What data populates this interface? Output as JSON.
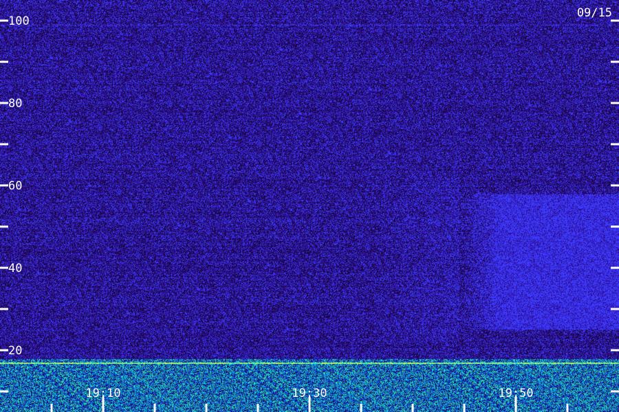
{
  "chart_data": {
    "type": "heatmap",
    "date_label": "09/15",
    "y_tick_labels": [
      "100",
      "80",
      "60",
      "40",
      "20"
    ],
    "y_ticks": [
      100,
      90,
      80,
      70,
      60,
      50,
      40,
      30,
      20,
      10
    ],
    "ylim": [
      5,
      105
    ],
    "x_tick_labels": [
      {
        "label": "19:10",
        "t": 10
      },
      {
        "label": "19:30",
        "t": 30
      },
      {
        "label": "19:50",
        "t": 50
      }
    ],
    "x_minor_ticks": [
      5,
      10,
      15,
      20,
      25,
      30,
      35,
      40,
      45,
      50,
      55
    ],
    "xlim": [
      0,
      60
    ],
    "colors": {
      "background": "#2a0d5a",
      "noise_dark": "#1a0840",
      "noise_mid": "#3a1aa0",
      "noise_bright": "#4a2ae8",
      "band_cyan": "#00c8e8",
      "band_green": "#50ff90",
      "band_yellow": "#e8ff40",
      "axis": "#ffffff"
    },
    "features": {
      "low_band_top": 18,
      "strong_line": 17,
      "line_100": 99,
      "enhanced_region": {
        "t_start": 44.5,
        "t_end": 60,
        "f_low": 25,
        "f_high": 58
      }
    }
  }
}
